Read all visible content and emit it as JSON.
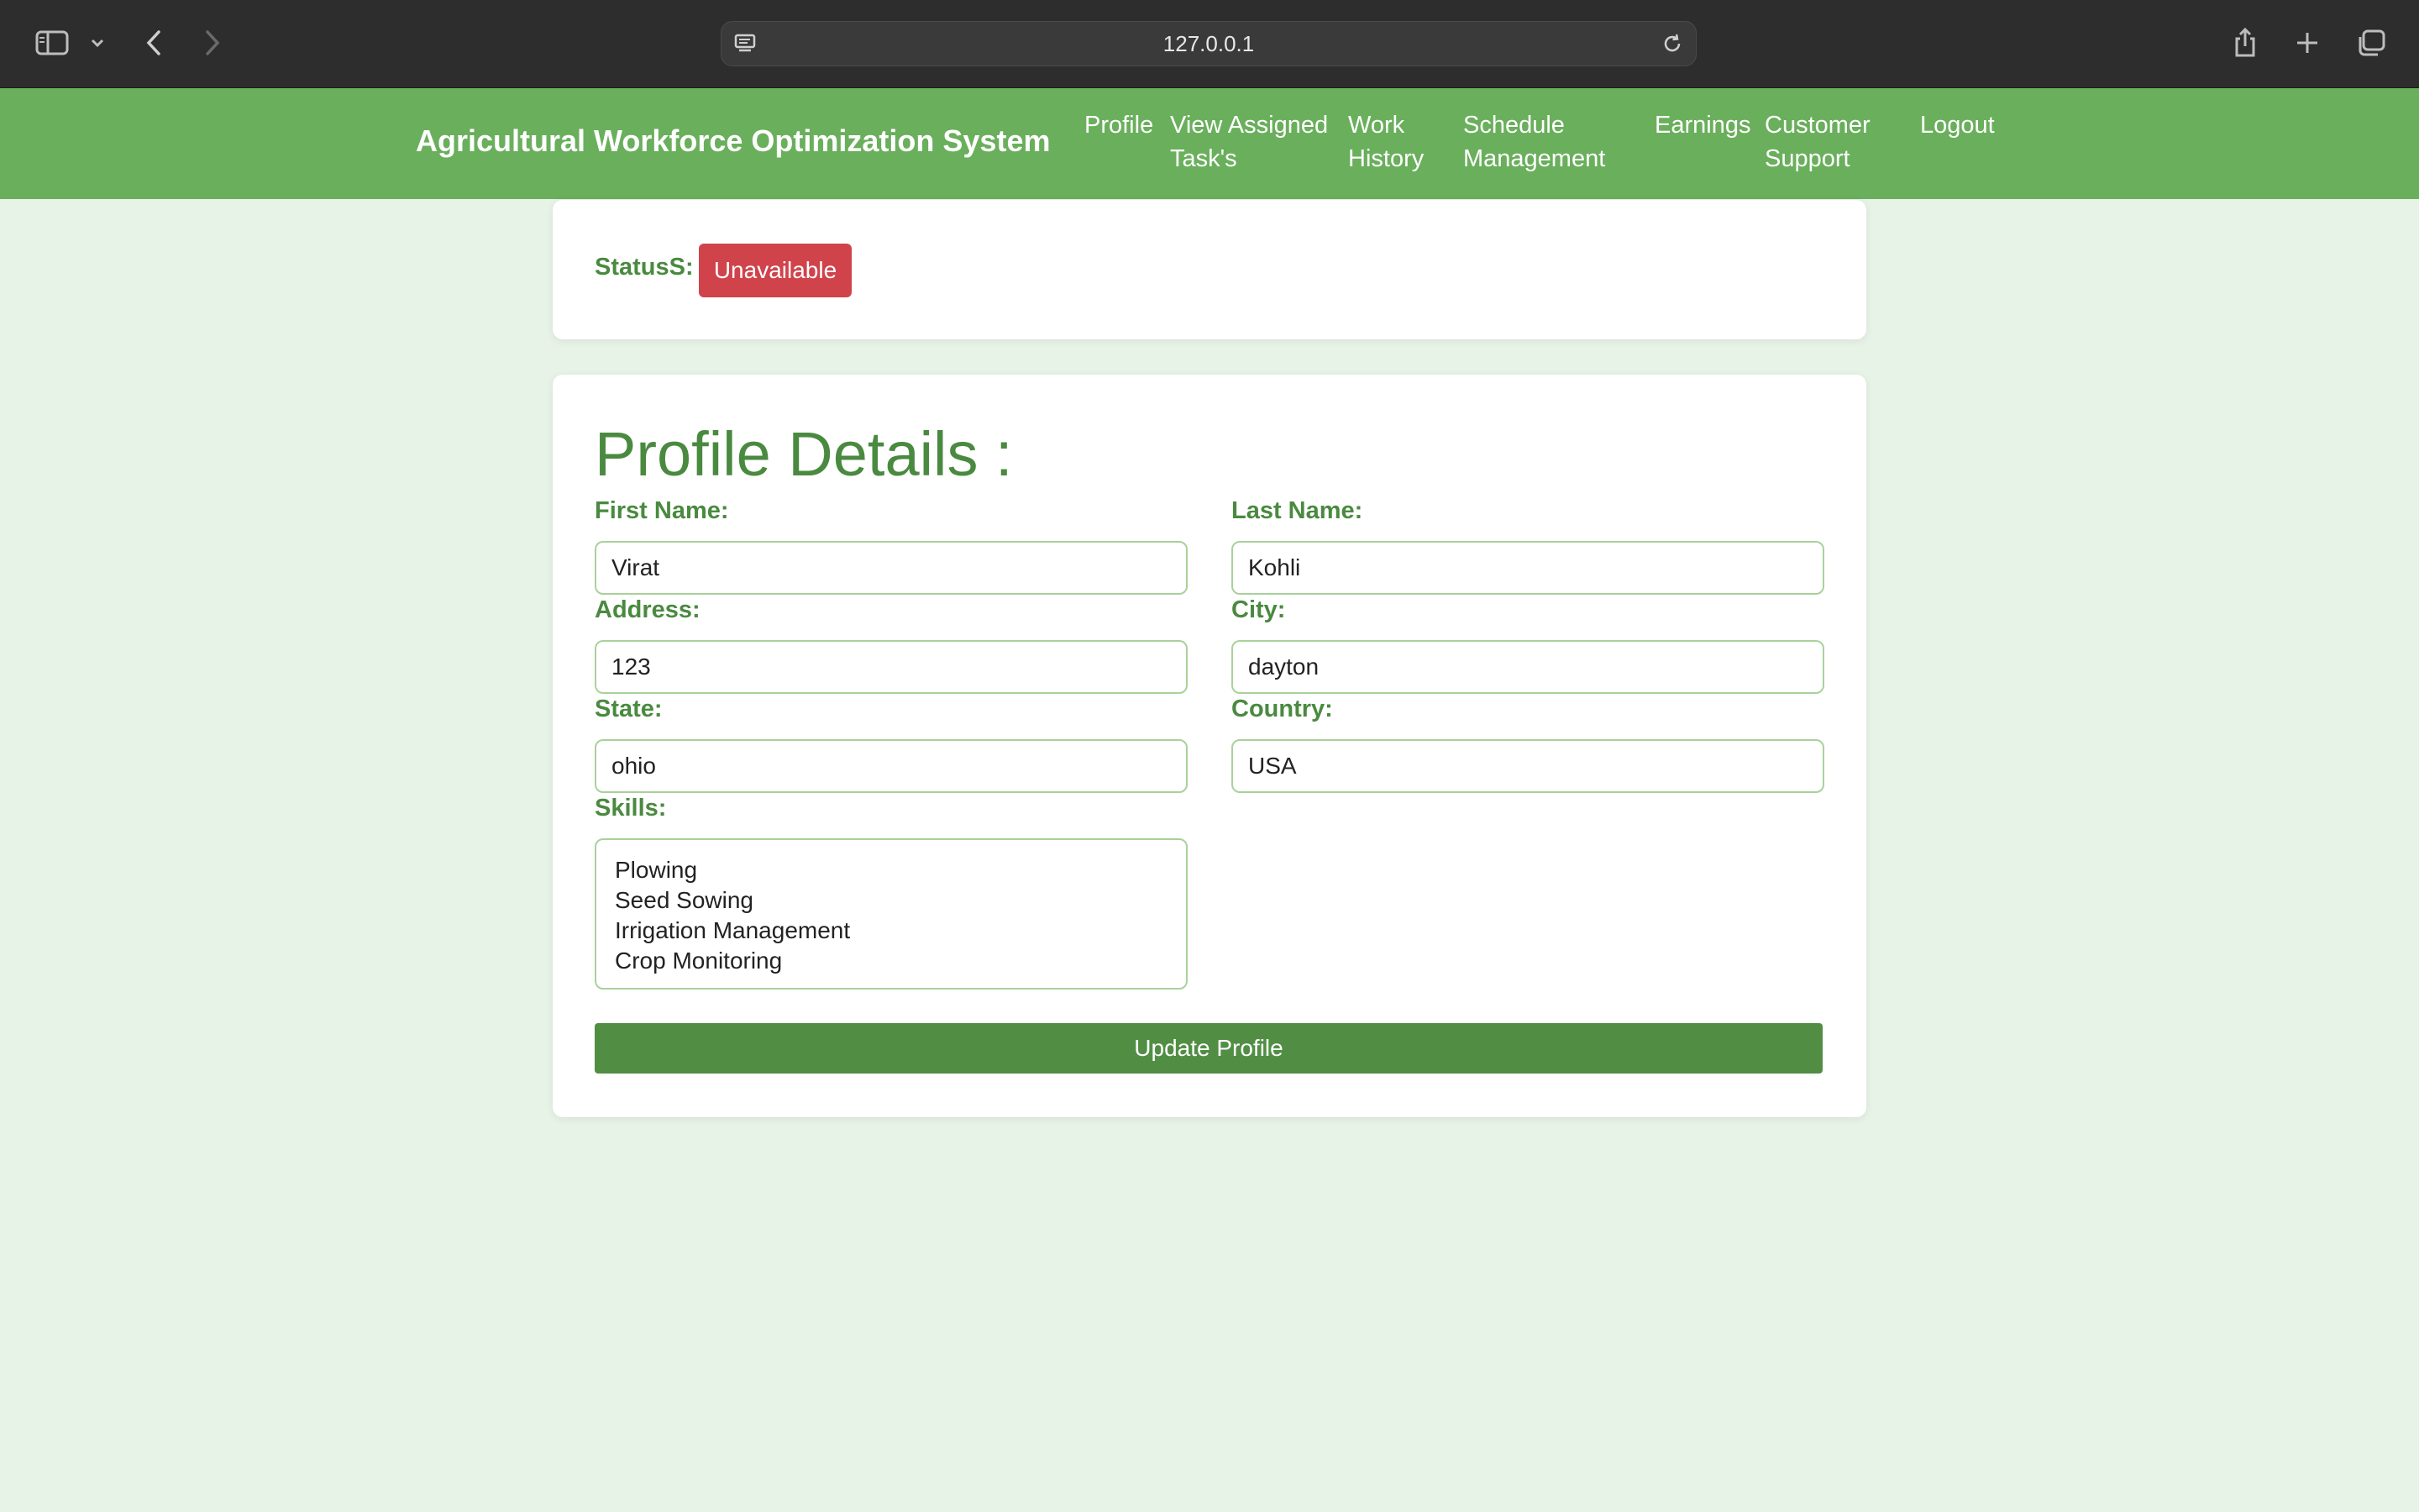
{
  "browser": {
    "url": "127.0.0.1"
  },
  "nav": {
    "brand": "Agricultural Workforce Optimization System",
    "links": [
      {
        "line1": "Profile",
        "line2": ""
      },
      {
        "line1": "View Assigned",
        "line2": "Task's"
      },
      {
        "line1": "Work",
        "line2": "History"
      },
      {
        "line1": "Schedule",
        "line2": "Management"
      },
      {
        "line1": "Earnings",
        "line2": ""
      },
      {
        "line1": "Customer",
        "line2": "Support"
      },
      {
        "line1": "Logout",
        "line2": ""
      }
    ]
  },
  "status": {
    "label": "StatusS:",
    "value": "Unavailable",
    "color": "#d0434b"
  },
  "profile": {
    "title": "Profile Details :",
    "first_name_label": "First Name:",
    "first_name": "Virat",
    "last_name_label": "Last Name:",
    "last_name": "Kohli",
    "address_label": "Address:",
    "address": "123",
    "city_label": "City:",
    "city": "dayton",
    "state_label": "State:",
    "state": "ohio",
    "country_label": "Country:",
    "country": "USA",
    "skills_label": "Skills:",
    "skills": [
      "Plowing",
      "Seed Sowing",
      "Irrigation Management",
      "Crop Monitoring"
    ],
    "update_button": "Update Profile"
  },
  "colors": {
    "nav_bg": "#6aaf5c",
    "page_bg": "#e8f3e8",
    "accent": "#4a8a40",
    "button": "#518e44"
  }
}
